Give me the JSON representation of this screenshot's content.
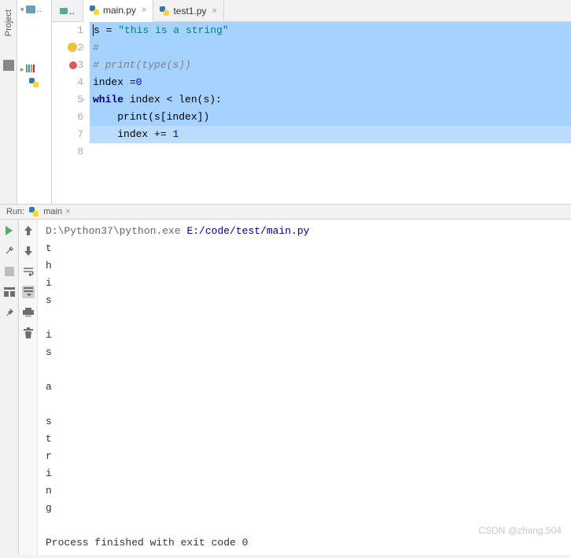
{
  "sidebar": {
    "label": "Project"
  },
  "tabs": [
    {
      "label": "main.py",
      "active": true
    },
    {
      "label": "test1.py",
      "active": false
    }
  ],
  "code": {
    "lines": [
      {
        "n": 1,
        "segments": [
          [
            "var",
            "s"
          ],
          [
            "op",
            " = "
          ],
          [
            "str",
            "\"this is a string\""
          ]
        ],
        "sel": true,
        "caret": true
      },
      {
        "n": 2,
        "segments": [
          [
            "com",
            "#"
          ]
        ],
        "sel": true,
        "bulb": true
      },
      {
        "n": 3,
        "segments": [
          [
            "com",
            "# print(type(s))"
          ]
        ],
        "sel": true,
        "breakpoint": true
      },
      {
        "n": 4,
        "segments": [
          [
            "var",
            "index "
          ],
          [
            "op",
            "="
          ],
          [
            "num",
            "0"
          ]
        ],
        "sel": true
      },
      {
        "n": 5,
        "segments": [
          [
            "kw",
            "while"
          ],
          [
            "op",
            " index < "
          ],
          [
            "fn",
            "len"
          ],
          [
            "op",
            "(s):"
          ]
        ],
        "sel": true
      },
      {
        "n": 6,
        "segments": [
          [
            "ind",
            "    "
          ],
          [
            "fn",
            "print"
          ],
          [
            "op",
            "(s[index])"
          ]
        ],
        "sel": true
      },
      {
        "n": 7,
        "segments": [
          [
            "ind",
            "    "
          ],
          [
            "var",
            "index "
          ],
          [
            "op",
            "+= "
          ],
          [
            "num",
            "1"
          ]
        ],
        "sel": true,
        "sel_end": true
      },
      {
        "n": 8,
        "segments": []
      }
    ]
  },
  "run": {
    "label": "Run:",
    "config": "main",
    "command_prefix": "D:\\Python37\\python.exe ",
    "command_arg": "E:/code/test/main.py",
    "output": [
      "t",
      "h",
      "i",
      "s",
      "",
      "i",
      "s",
      "",
      "a",
      "",
      "s",
      "t",
      "r",
      "i",
      "n",
      "g"
    ],
    "exit": "Process finished with exit code 0"
  },
  "watermark": "CSDN @zhang.504"
}
